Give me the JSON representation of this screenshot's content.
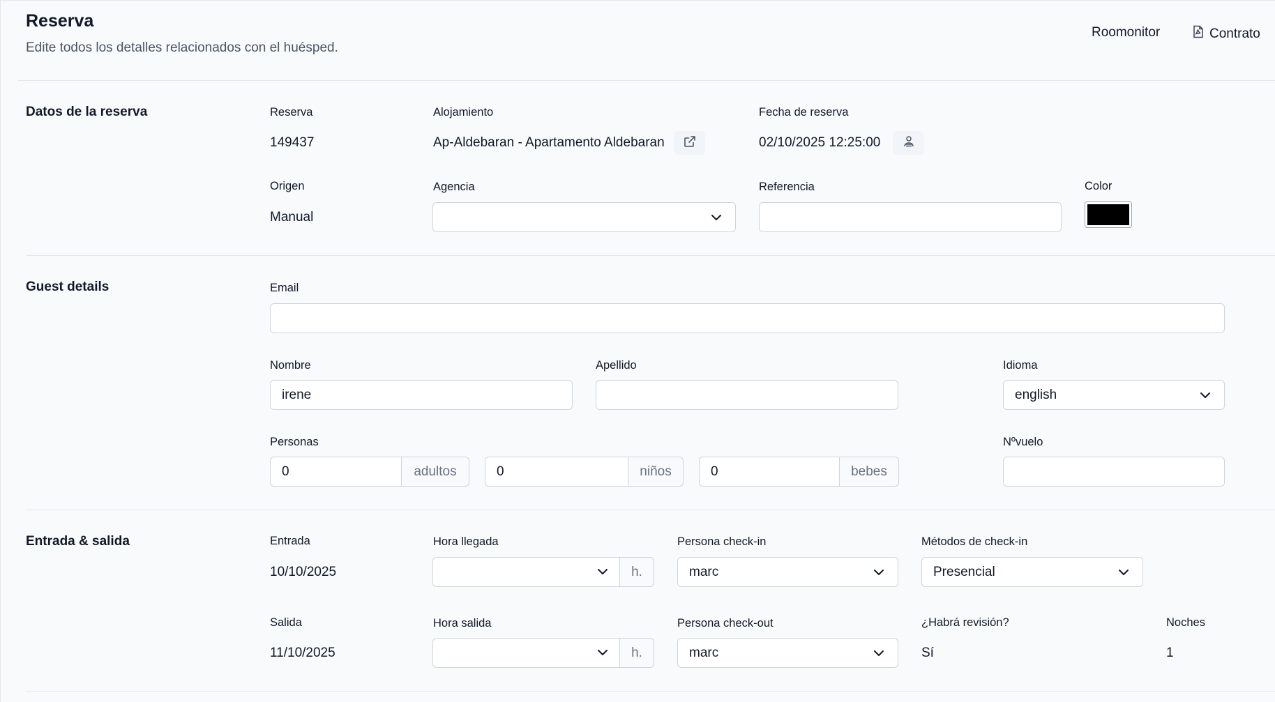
{
  "header": {
    "title": "Reserva",
    "subtitle": "Edite todos los detalles relacionados con el huésped.",
    "roomonitor_label": "Roomonitor",
    "contrato_label": "Contrato"
  },
  "booking": {
    "section_title": "Datos de la reserva",
    "reserva_label": "Reserva",
    "reserva_value": "149437",
    "alojamiento_label": "Alojamiento",
    "alojamiento_value": "Ap-Aldebaran - Apartamento Aldebaran",
    "fecha_label": "Fecha de reserva",
    "fecha_value": "02/10/2025 12:25:00",
    "origen_label": "Origen",
    "origen_value": "Manual",
    "agencia_label": "Agencia",
    "agencia_value": "",
    "referencia_label": "Referencia",
    "referencia_value": "",
    "color_label": "Color",
    "color_value": "#000000"
  },
  "guest": {
    "section_title": "Guest details",
    "email_label": "Email",
    "email_value": "",
    "nombre_label": "Nombre",
    "nombre_value": "irene",
    "apellido_label": "Apellido",
    "apellido_value": "",
    "idioma_label": "Idioma",
    "idioma_value": "english",
    "personas_label": "Personas",
    "adultos_value": "0",
    "adultos_addon": "adultos",
    "ninos_value": "0",
    "ninos_addon": "niños",
    "bebes_value": "0",
    "bebes_addon": "bebes",
    "vuelo_label": "Nºvuelo",
    "vuelo_value": ""
  },
  "stay": {
    "section_title": "Entrada & salida",
    "entrada_label": "Entrada",
    "entrada_value": "10/10/2025",
    "hora_llegada_label": "Hora llegada",
    "hora_llegada_value": "",
    "hora_addon": "h.",
    "persona_checkin_label": "Persona check-in",
    "persona_checkin_value": "marc",
    "metodos_label": "Métodos de check-in",
    "metodos_value": "Presencial",
    "salida_label": "Salida",
    "salida_value": "11/10/2025",
    "hora_salida_label": "Hora salida",
    "hora_salida_value": "",
    "persona_checkout_label": "Persona check-out",
    "persona_checkout_value": "marc",
    "revision_label": "¿Habrá revisión?",
    "revision_value": "Sí",
    "noches_label": "Noches",
    "noches_value": "1"
  },
  "icons": {
    "contrato": "document-icon",
    "alojamiento_link": "external-link-icon",
    "fecha_action": "user-list-icon",
    "select_chevron": "chevron-down-icon"
  }
}
